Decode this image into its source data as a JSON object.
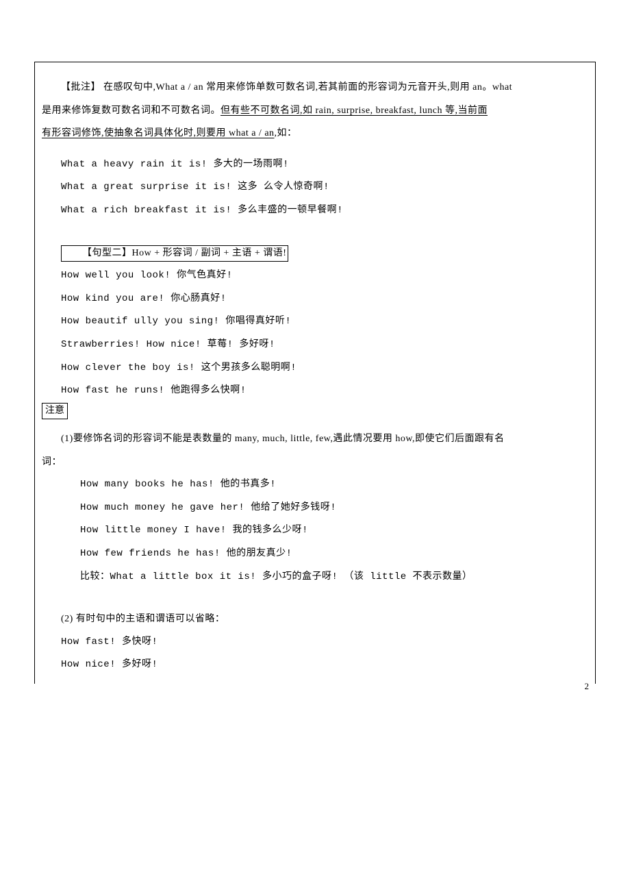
{
  "annotation": {
    "prefix": "【批注】 ",
    "line1_a": "在感叹句中,What a / an 常用来修饰单数可数名词,若其前面的形容词为元音开头,则用 an。what",
    "line2_a": "是用来",
    "line2_b": "修饰复数可数名词和不可数名词。",
    "line2_c": "但有些不可数名词,如 rain, surprise, breakfast, lunch 等,当前面",
    "line3_a": "有形容词修饰,使抽象名词具体化时,则要用 what a / an",
    "line3_b": ",如："
  },
  "examples1": [
    "What a heavy rain it is! 多大的一场雨啊!",
    "What a great surprise it is! 这多 么令人惊奇啊!",
    "What a rich breakfast it is! 多么丰盛的一顿早餐啊!"
  ],
  "pattern2": {
    "label": "【句型二】How + 形容词 / 副词 + 主语 + 谓语!"
  },
  "examples2": [
    "How well you look! 你气色真好!",
    "How kind you are! 你心肠真好!",
    "How beautif ully you sing! 你唱得真好听!",
    "Strawberries! How nice! 草莓! 多好呀!",
    "How clever the boy is! 这个男孩多么聪明啊!",
    "How fast he runs! 他跑得多么快啊!"
  ],
  "note_label": "注意",
  "note1": {
    "head": "(1)要修饰名词的形容词不能是表数量的 many, much, little, few,遇此情况要用 how,即使它们后面跟有名",
    "tail": "词：",
    "items": [
      "How many books he has!  他的书真多!",
      "How much money he gave her!  他给了她好多钱呀!",
      "How little money I have!  我的钱多么少呀!",
      "How few friends he has!  他的朋友真少!"
    ],
    "compare": "比较：What a little box it is!  多小巧的盒子呀! （该 little 不表示数量）"
  },
  "note2": {
    "head": "(2) 有时句中的主语和谓语可以省略：",
    "items": [
      "How fast!  多快呀!",
      "How nice!  多好呀!"
    ]
  },
  "page_number": "2"
}
